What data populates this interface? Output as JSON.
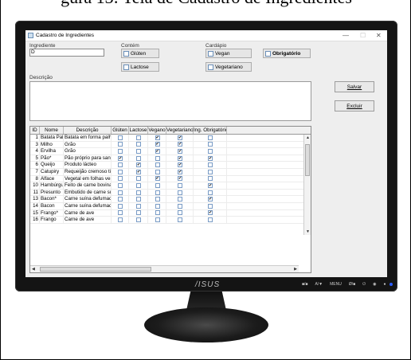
{
  "caption": "gura 13: Tela de Cadastro de Ingredientes",
  "monitor": {
    "brand": "/ISUS",
    "controls": [
      "■/■",
      "A/▼",
      "MENU",
      "Ø/■",
      "⏻",
      "◉",
      "●"
    ]
  },
  "window": {
    "title": "Cadastro de Ingredientes",
    "min": "—",
    "max": "☐",
    "close": "✕"
  },
  "form": {
    "ingrediente_label": "Ingrediente",
    "ingrediente_value": "D",
    "contem_label": "Contém",
    "gluten": "Glúten",
    "lactose": "Lactose",
    "cardapio_label": "Cardápio",
    "vegan": "Vegan",
    "vegetariano": "Vegetariano",
    "obrigatorio": "Obrigatório",
    "descricao_label": "Descrição",
    "salvar": "Salvar",
    "excluir": "Excluir"
  },
  "table": {
    "columns": [
      "ID",
      "Nome",
      "Descrição",
      "Glúten",
      "Lactose",
      "Vegano",
      "Vegetariano",
      "Ing. Obrigatório"
    ],
    "rows": [
      {
        "id": "1",
        "nome": "Batata Palha",
        "desc": "Batata em forma palha,...",
        "g": false,
        "l": false,
        "vg": true,
        "vt": true,
        "ob": false
      },
      {
        "id": "3",
        "nome": "Milho",
        "desc": "Grão",
        "g": false,
        "l": false,
        "vg": true,
        "vt": true,
        "ob": false
      },
      {
        "id": "4",
        "nome": "Ervilha",
        "desc": "Grão",
        "g": false,
        "l": false,
        "vg": true,
        "vt": true,
        "ob": false
      },
      {
        "id": "5",
        "nome": "Pão*",
        "desc": "Pão próprio para sand...",
        "g": true,
        "l": false,
        "vg": false,
        "vt": true,
        "ob": true
      },
      {
        "id": "6",
        "nome": "Queijo",
        "desc": "Produto lácteo",
        "g": false,
        "l": true,
        "vg": false,
        "vt": true,
        "ob": false
      },
      {
        "id": "7",
        "nome": "Catupiry",
        "desc": "Requeijão cremoso tip...",
        "g": false,
        "l": true,
        "vg": false,
        "vt": true,
        "ob": false
      },
      {
        "id": "8",
        "nome": "Alface",
        "desc": "Vegetal em folhas verd...",
        "g": false,
        "l": false,
        "vg": true,
        "vt": true,
        "ob": false
      },
      {
        "id": "10",
        "nome": "Hambúrguer*",
        "desc": "Feito de carne bovina",
        "g": false,
        "l": false,
        "vg": false,
        "vt": false,
        "ob": true
      },
      {
        "id": "11",
        "nome": "Presunto",
        "desc": "Embutido de carne suí...",
        "g": false,
        "l": false,
        "vg": false,
        "vt": false,
        "ob": false
      },
      {
        "id": "13",
        "nome": "Bacon*",
        "desc": "Carne suína defumada",
        "g": false,
        "l": false,
        "vg": false,
        "vt": false,
        "ob": true
      },
      {
        "id": "14",
        "nome": "Bacon",
        "desc": "Carne suína defumada",
        "g": false,
        "l": false,
        "vg": false,
        "vt": false,
        "ob": false
      },
      {
        "id": "15",
        "nome": "Frango*",
        "desc": "Carne de ave",
        "g": false,
        "l": false,
        "vg": false,
        "vt": false,
        "ob": true
      },
      {
        "id": "16",
        "nome": "Frango",
        "desc": "Carne de ave",
        "g": false,
        "l": false,
        "vg": false,
        "vt": false,
        "ob": false
      }
    ]
  }
}
